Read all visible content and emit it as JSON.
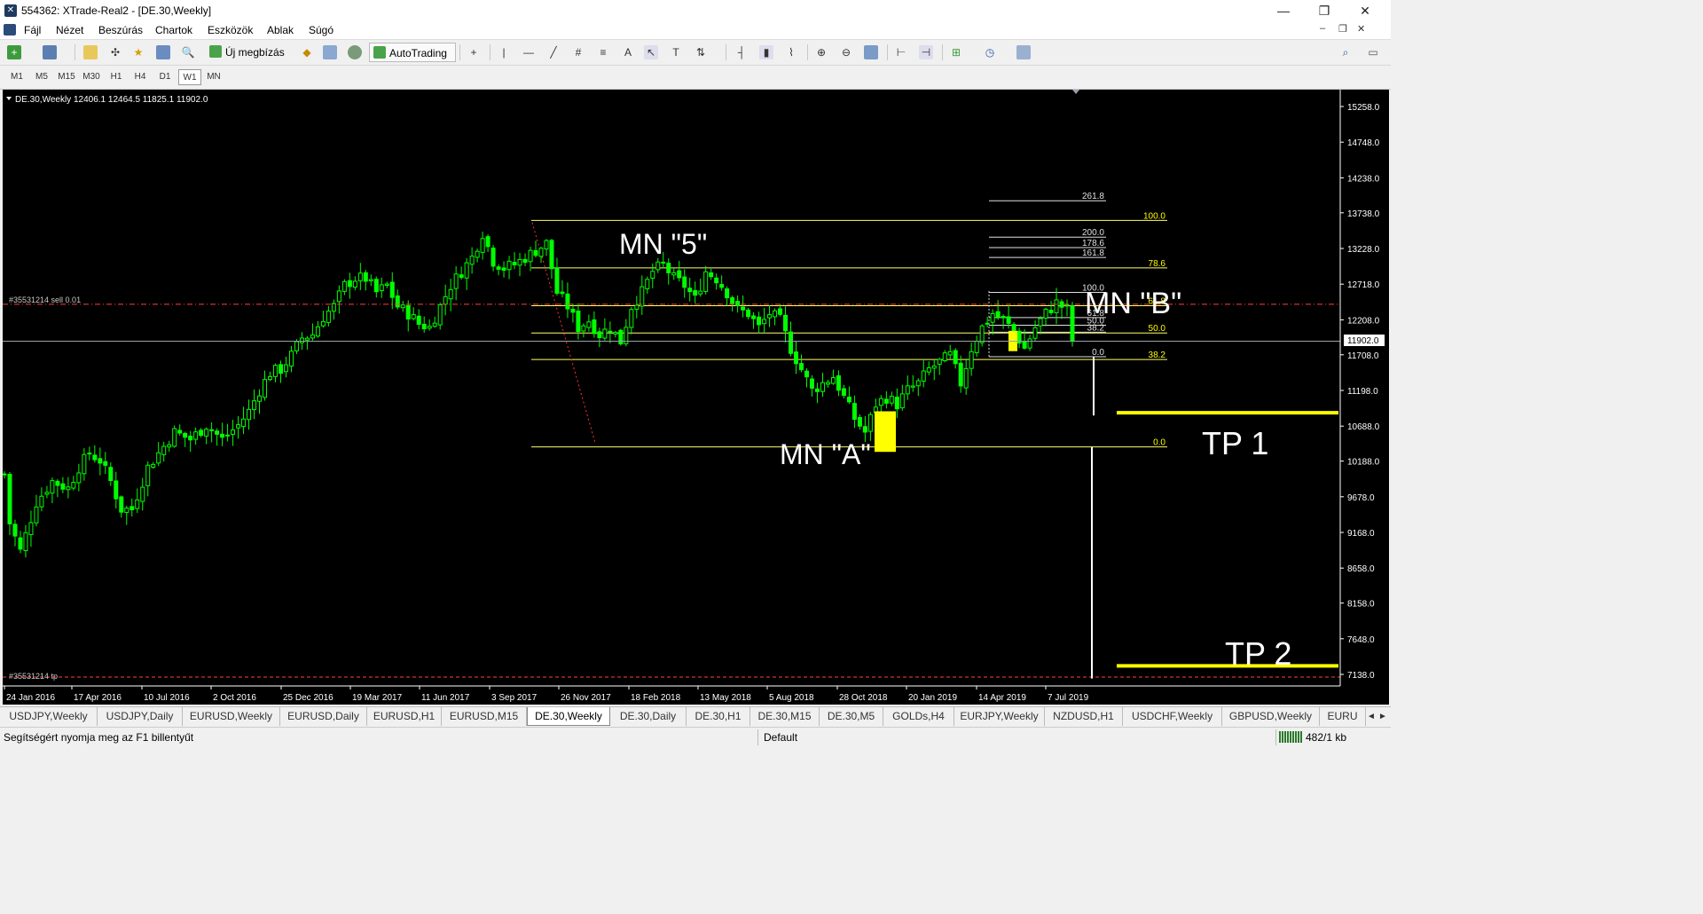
{
  "window": {
    "title": "554362: XTrade-Real2 - [DE.30,Weekly]",
    "minimize": "—",
    "restore": "❐",
    "close": "✕"
  },
  "menu": [
    "Fájl",
    "Nézet",
    "Beszúrás",
    "Chartok",
    "Eszközök",
    "Ablak",
    "Súgó"
  ],
  "mdi_controls": [
    "–",
    "❐",
    "✕"
  ],
  "toolbar": {
    "new_order": "Új megbízás",
    "autotrading": "AutoTrading",
    "icons": [
      "new-chart-icon",
      "profiles-icon",
      "market-watch-icon",
      "navigator-icon",
      "favorites-icon",
      "terminal-icon",
      "tester-icon",
      "new-order-icon",
      "signals-icon",
      "market-icon",
      "autotrading-icon",
      "crosshair-icon",
      "vertical-line-icon",
      "horizontal-line-icon",
      "trendline-icon",
      "equidistant-channel-icon",
      "fibonacci-icon",
      "text-icon",
      "cursor-icon",
      "text-label-icon",
      "arrows-icon",
      "bar-chart-icon",
      "candlestick-icon",
      "line-chart-icon",
      "zoom-in-icon",
      "zoom-out-icon",
      "tile-windows-icon",
      "auto-scroll-icon",
      "chart-shift-icon",
      "indicators-icon",
      "periods-icon",
      "templates-icon",
      "search-icon",
      "chat-icon"
    ]
  },
  "timeframes": [
    "M1",
    "M5",
    "M15",
    "M30",
    "H1",
    "H4",
    "D1",
    "W1",
    "MN"
  ],
  "active_timeframe": "W1",
  "chart": {
    "symbol_line": "DE.30,Weekly  12406.1 12464.5 11825.1 11902.0",
    "current_price_label": "11902.0",
    "sell_label": "#35531214 sell 0.01",
    "tp_label": "#35531214 tp",
    "annotations": {
      "mn5": "MN \"5\"",
      "mna": "MN \"A\"",
      "mnb": "MN \"B\"",
      "tp1": "TP 1",
      "tp2": "TP 2"
    },
    "colors": {
      "background": "#000000",
      "candle": "#00ff00",
      "fib": "#ffff66",
      "fib_label": "#ffff00",
      "highlight": "#ffff00",
      "text": "#ffffff",
      "order_line": "#ff4040"
    }
  },
  "chart_data": {
    "type": "candlestick",
    "ylim": [
      6900,
      15500
    ],
    "yticks": [
      15258.0,
      14748.0,
      14238.0,
      13738.0,
      13228.0,
      12718.0,
      12208.0,
      11708.0,
      11198.0,
      10688.0,
      10188.0,
      9678.0,
      9168.0,
      8658.0,
      8158.0,
      7648.0,
      7138.0
    ],
    "xlabels": [
      "24 Jan 2016",
      "17 Apr 2016",
      "10 Jul 2016",
      "2 Oct 2016",
      "25 Dec 2016",
      "19 Mar 2017",
      "11 Jun 2017",
      "3 Sep 2017",
      "26 Nov 2017",
      "18 Feb 2018",
      "13 May 2018",
      "5 Aug 2018",
      "28 Oct 2018",
      "20 Jan 2019",
      "14 Apr 2019",
      "7 Jul 2019"
    ],
    "last_ohlc": {
      "open": 12406.1,
      "high": 12464.5,
      "low": 11825.1,
      "close": 11902.0
    },
    "current_price": 11902.0,
    "sell_entry": 12430,
    "take_profit": 7100,
    "fib_large": {
      "levels": [
        {
          "label": "100.0",
          "price": 13630
        },
        {
          "label": "78.6",
          "price": 12950
        },
        {
          "label": "61.8",
          "price": 12410
        },
        {
          "label": "50.0",
          "price": 12020
        },
        {
          "label": "38.2",
          "price": 11640
        },
        {
          "label": "0.0",
          "price": 10390
        }
      ]
    },
    "fib_small": {
      "levels": [
        {
          "label": "261.8",
          "price": 13910
        },
        {
          "label": "200.0",
          "price": 13390
        },
        {
          "label": "178.6",
          "price": 13240
        },
        {
          "label": "161.8",
          "price": 13100
        },
        {
          "label": "100.0",
          "price": 12600
        },
        {
          "label": "61.8",
          "price": 12240
        },
        {
          "label": "50.0",
          "price": 12130
        },
        {
          "label": "38.2",
          "price": 12030
        },
        {
          "label": "0.0",
          "price": 11680
        }
      ]
    },
    "targets": [
      {
        "name": "TP 1",
        "price": 10880
      },
      {
        "name": "TP 2",
        "price": 7260
      }
    ]
  },
  "tabs": [
    "USDJPY,Weekly",
    "USDJPY,Daily",
    "EURUSD,Weekly",
    "EURUSD,Daily",
    "EURUSD,H1",
    "EURUSD,M15",
    "DE.30,Weekly",
    "DE.30,Daily",
    "DE.30,H1",
    "DE.30,M15",
    "DE.30,M5",
    "GOLDs,H4",
    "EURJPY,Weekly",
    "NZDUSD,H1",
    "USDCHF,Weekly",
    "GBPUSD,Weekly",
    "EURU"
  ],
  "active_tab": "DE.30,Weekly",
  "tab_arrows": [
    "◄",
    "►"
  ],
  "status": {
    "help": "Segítségért nyomja meg az F1 billentyűt",
    "profile": "Default",
    "traffic": "482/1 kb"
  }
}
